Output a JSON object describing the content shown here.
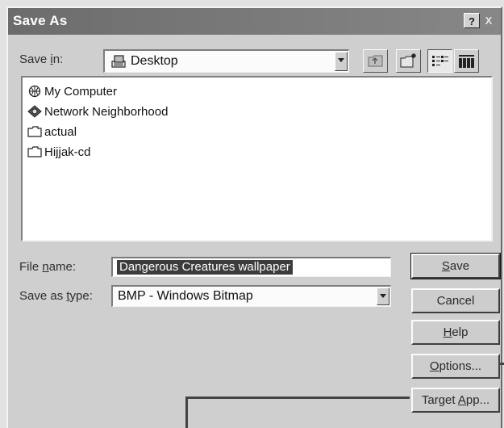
{
  "window": {
    "title": "Save As",
    "help_glyph": "?",
    "close_glyph": "X"
  },
  "save_in": {
    "label_pre": "Save ",
    "label_key": "i",
    "label_post": "n:",
    "value": "Desktop",
    "icon": "desktop-icon"
  },
  "toolbar": {
    "buttons": [
      "up-one-level-icon",
      "create-new-folder-icon",
      "list-view-icon",
      "details-view-icon"
    ]
  },
  "files": [
    {
      "name": "My Computer",
      "icon": "my-computer-icon"
    },
    {
      "name": "Network Neighborhood",
      "icon": "network-neighborhood-icon"
    },
    {
      "name": "actual",
      "icon": "folder-icon"
    },
    {
      "name": "Hijjak-cd",
      "icon": "folder-icon"
    }
  ],
  "file_name": {
    "label_pre": "File ",
    "label_key": "n",
    "label_post": "ame:",
    "value": "Dangerous Creatures wallpaper"
  },
  "save_type": {
    "label_pre": "Save as ",
    "label_key": "t",
    "label_post": "ype:",
    "value": "BMP - Windows Bitmap"
  },
  "buttons": {
    "save_key": "S",
    "save_rest": "ave",
    "cancel": "Cancel",
    "help_key": "H",
    "help_rest": "elp",
    "options_key": "O",
    "options_rest": "ptions...",
    "target_pre": "Target ",
    "target_key": "A",
    "target_post": "pp..."
  },
  "colors": {
    "titlebar": "#7a7a7a",
    "dialog_face": "#cfcfcf",
    "selection": "#3c3c3c"
  }
}
